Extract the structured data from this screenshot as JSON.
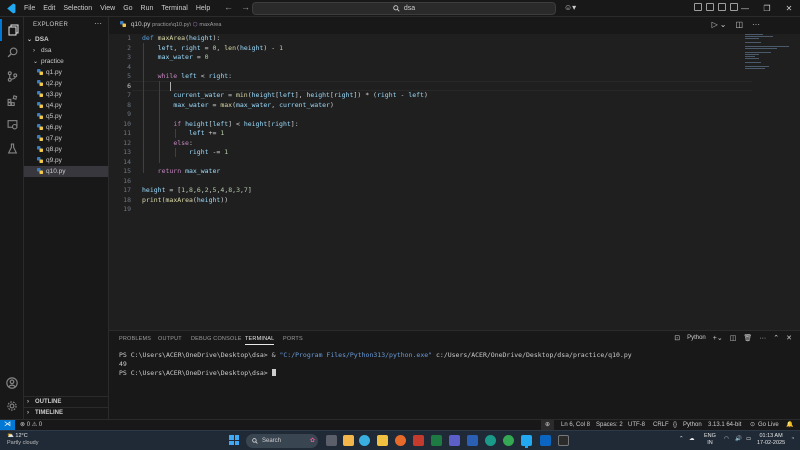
{
  "titlebar": {
    "menu": [
      "File",
      "Edit",
      "Selection",
      "View",
      "Go",
      "Run",
      "Terminal",
      "Help"
    ],
    "search_text": "dsa"
  },
  "sidebar": {
    "title": "EXPLORER",
    "root": "DSA",
    "items": [
      {
        "label": "dsa",
        "kind": "folder",
        "expanded": false
      },
      {
        "label": "practice",
        "kind": "folder",
        "expanded": true
      },
      {
        "label": "q1.py",
        "kind": "file"
      },
      {
        "label": "q2.py",
        "kind": "file"
      },
      {
        "label": "q3.py",
        "kind": "file"
      },
      {
        "label": "q4.py",
        "kind": "file"
      },
      {
        "label": "q5.py",
        "kind": "file"
      },
      {
        "label": "q6.py",
        "kind": "file"
      },
      {
        "label": "q7.py",
        "kind": "file"
      },
      {
        "label": "q8.py",
        "kind": "file"
      },
      {
        "label": "q9.py",
        "kind": "file"
      },
      {
        "label": "q10.py",
        "kind": "file",
        "selected": true
      }
    ],
    "outline": "OUTLINE",
    "timeline": "TIMELINE"
  },
  "editor": {
    "tab_file": "q10.py",
    "breadcrumb_path": "practice\\q10.py\\",
    "breadcrumb_symbol": "maxArea",
    "current_line": 6,
    "lines": [
      "def maxArea(height):",
      "    left, right = 0, len(height) - 1",
      "    max_water = 0",
      "",
      "    while left < right:",
      "",
      "        current_water = min(height[left], height[right]) * (right - left)",
      "        max_water = max(max_water, current_water)",
      "",
      "        if height[left] < height[right]:",
      "            left += 1",
      "        else:",
      "            right -= 1",
      "",
      "    return max_water",
      "",
      "height = [1,8,6,2,5,4,8,3,7]",
      "print(maxArea(height))"
    ]
  },
  "panel": {
    "tabs": [
      "PROBLEMS",
      "OUTPUT",
      "DEBUG CONSOLE",
      "TERMINAL",
      "PORTS"
    ],
    "active_tab": "TERMINAL",
    "shell_label": "Python",
    "terminal": {
      "prompt1": "PS C:\\Users\\ACER\\OneDrive\\Desktop\\dsa> & ",
      "exe": "\"C:/Program Files/Python313/python.exe\"",
      "script": " c:/Users/ACER/OneDrive/Desktop/dsa/practice/q10.py",
      "output": "49",
      "prompt2": "PS C:\\Users\\ACER\\OneDrive\\Desktop\\dsa> "
    }
  },
  "statusbar": {
    "errors": "0",
    "warnings": "0",
    "position": "Ln 6, Col 8",
    "spaces": "Spaces: 2",
    "encoding": "UTF-8",
    "eol": "CRLF",
    "language": "Python",
    "interpreter": "3.13.1 64-bit",
    "golive": "Go Live"
  },
  "taskbar": {
    "temp": "12°C",
    "condition": "Partly cloudy",
    "search_placeholder": "Search",
    "lang_top": "ENG",
    "lang_bottom": "IN",
    "time": "01:13 AM",
    "date": "17-02-2025"
  },
  "colors": {
    "accent": "#0078d4",
    "keyword": "#569cd6",
    "control": "#c586c0",
    "function": "#dcdcaa",
    "number": "#b5cea8",
    "variable": "#9cdcfe"
  }
}
